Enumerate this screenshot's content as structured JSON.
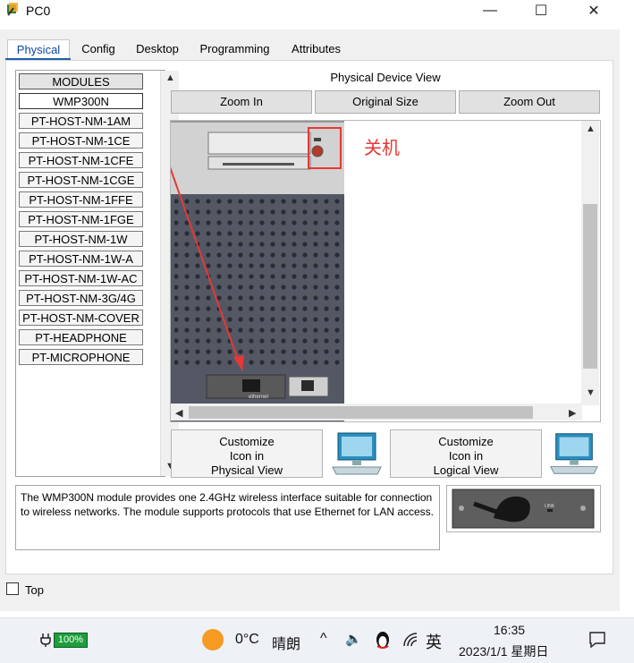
{
  "window": {
    "title": "PC0",
    "minimize": "—",
    "maximize": "☐",
    "close": "✕"
  },
  "tabs": [
    {
      "label": "Physical"
    },
    {
      "label": "Config"
    },
    {
      "label": "Desktop"
    },
    {
      "label": "Programming"
    },
    {
      "label": "Attributes"
    }
  ],
  "modules": {
    "header": "MODULES",
    "items": [
      "WMP300N",
      "PT-HOST-NM-1AM",
      "PT-HOST-NM-1CE",
      "PT-HOST-NM-1CFE",
      "PT-HOST-NM-1CGE",
      "PT-HOST-NM-1FFE",
      "PT-HOST-NM-1FGE",
      "PT-HOST-NM-1W",
      "PT-HOST-NM-1W-A",
      "PT-HOST-NM-1W-AC",
      "PT-HOST-NM-3G/4G",
      "PT-HOST-NM-COVER",
      "PT-HEADPHONE",
      "PT-MICROPHONE"
    ]
  },
  "device_view": {
    "title": "Physical Device View",
    "zoom_in": "Zoom In",
    "original_size": "Original Size",
    "zoom_out": "Zoom Out",
    "annotation": "关机",
    "port_label": "ethernet",
    "annotation_color": "#e53935"
  },
  "customize": {
    "physical": [
      "Customize",
      "Icon in",
      "Physical View"
    ],
    "logical": [
      "Customize",
      "Icon in",
      "Logical View"
    ]
  },
  "description": "The WMP300N module provides one 2.4GHz wireless interface suitable for connection to wireless networks. The module supports protocols that use Ethernet for LAN access.",
  "module_image_label": "LINK",
  "top_checkbox": {
    "label": "Top",
    "checked": false
  },
  "taskbar": {
    "battery": "100%",
    "weather_temp": "0°C",
    "weather_text": "晴朗",
    "ime": "英",
    "time": "16:35",
    "date": "2023/1/1 星期日"
  }
}
